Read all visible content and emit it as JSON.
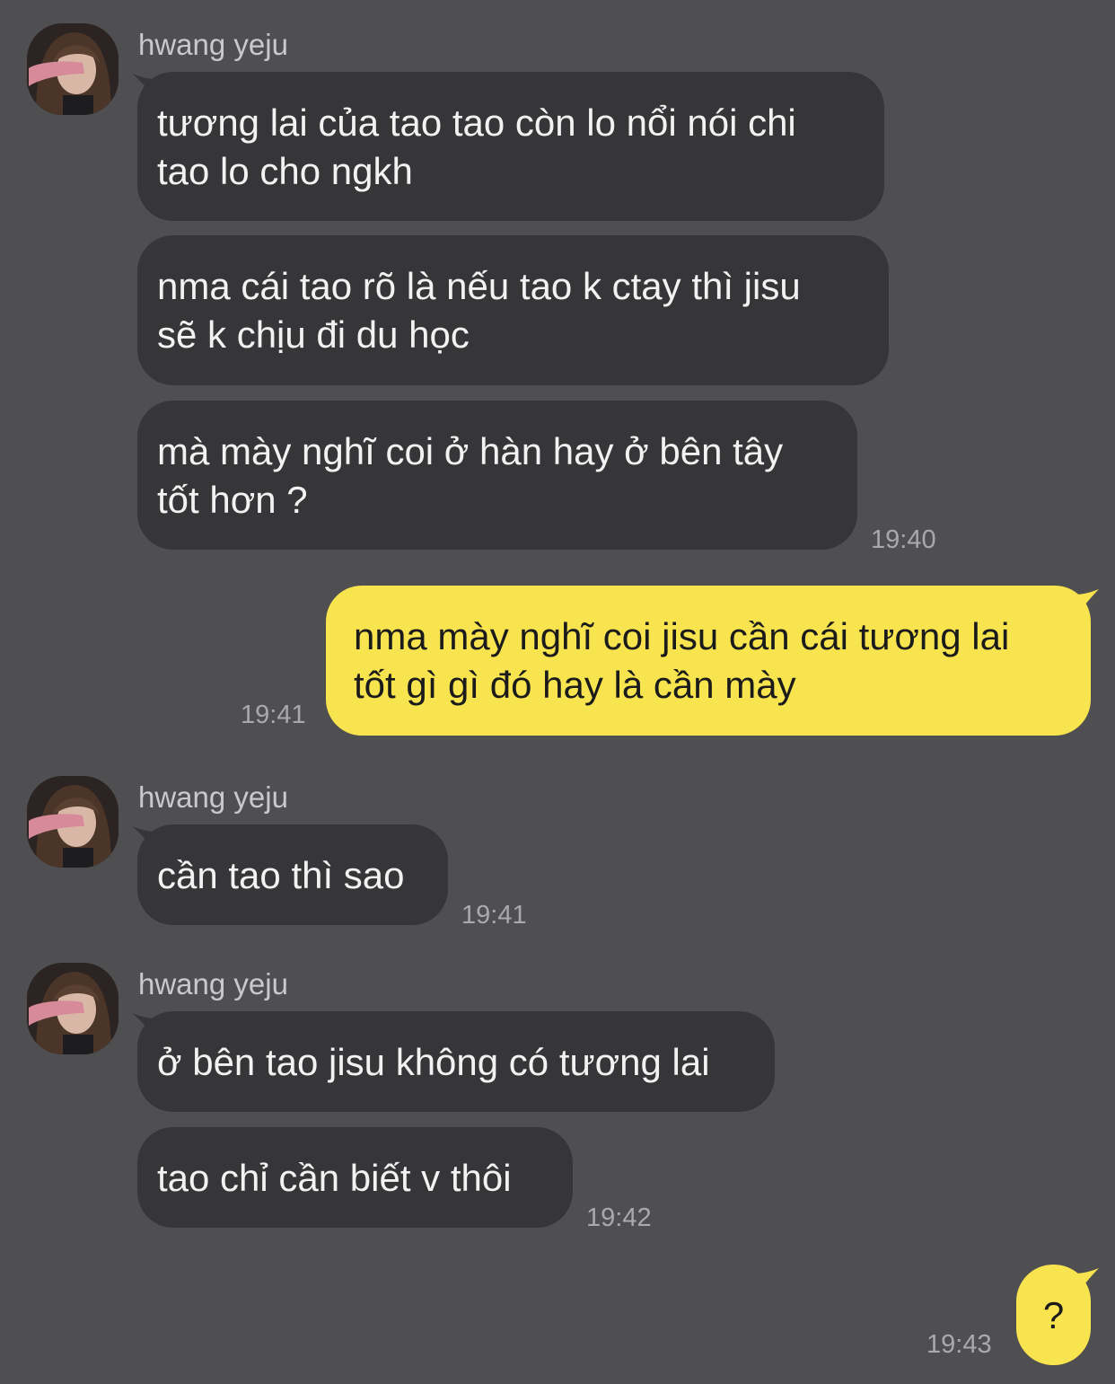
{
  "contact": {
    "name": "hwang yeju"
  },
  "messages": [
    {
      "sender": "hwang yeju",
      "text": "tương lai của tao tao còn lo nổi nói chi\ntao lo cho ngkh"
    },
    {
      "sender": "hwang yeju",
      "text": "nma cái tao rõ là nếu tao k ctay thì jisu\nsẽ k chịu đi du học"
    },
    {
      "sender": "hwang yeju",
      "text": "mà mày nghĩ coi ở hàn hay ở bên tây\ntốt hơn ?",
      "time": "19:40"
    },
    {
      "sender": "me",
      "text": "nma mày nghĩ coi jisu cần cái tương lai\ntốt gì gì đó hay là cần mày",
      "time": "19:41"
    },
    {
      "sender": "hwang yeju",
      "text": "cần tao thì sao",
      "time": "19:41"
    },
    {
      "sender": "hwang yeju",
      "text": "ở bên tao jisu không có tương lai"
    },
    {
      "sender": "hwang yeju",
      "text": "tao chỉ cần biết v thôi",
      "time": "19:42"
    },
    {
      "sender": "me",
      "text": "?",
      "time": "19:43"
    }
  ],
  "colors": {
    "background": "#4f4e50",
    "incoming_bubble": "#363538",
    "outgoing_bubble": "#f8e44e",
    "timestamp": "#a9a8ab",
    "name": "#c9c8cb"
  }
}
